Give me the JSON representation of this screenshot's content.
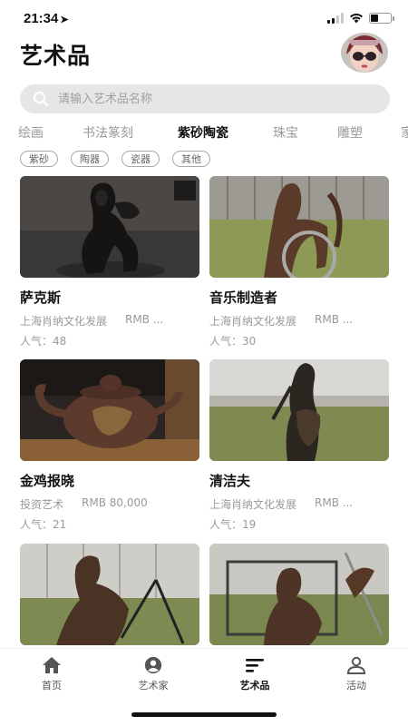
{
  "status_bar": {
    "time": "21:34",
    "location_glyph": "➤"
  },
  "header": {
    "title": "艺术品"
  },
  "search": {
    "placeholder": "请输入艺术品名称"
  },
  "category_tabs": [
    {
      "label": "绘画"
    },
    {
      "label": "书法篆刻"
    },
    {
      "label": "紫砂陶瓷",
      "active": true
    },
    {
      "label": "珠宝"
    },
    {
      "label": "雕塑"
    },
    {
      "label": "家"
    }
  ],
  "filter_chips": [
    {
      "label": "紫砂"
    },
    {
      "label": "陶器"
    },
    {
      "label": "瓷器"
    },
    {
      "label": "其他"
    }
  ],
  "artworks": [
    {
      "title": "萨克斯",
      "seller": "上海肖纳文化发展",
      "price": "RMB ...",
      "popularity": "人气：48"
    },
    {
      "title": "音乐制造者",
      "seller": "上海肖纳文化发展",
      "price": "RMB ...",
      "popularity": "人气：30"
    },
    {
      "title": "金鸡报晓",
      "seller": "投资艺术",
      "price": "RMB 80,000",
      "popularity": "人气：21"
    },
    {
      "title": "清洁夫",
      "seller": "上海肖纳文化发展",
      "price": "RMB ...",
      "popularity": "人气：19"
    },
    {
      "title": "",
      "seller": "",
      "price": "",
      "popularity": ""
    },
    {
      "title": "",
      "seller": "",
      "price": "",
      "popularity": ""
    }
  ],
  "bottom_nav": [
    {
      "label": "首页",
      "icon": "home-icon"
    },
    {
      "label": "艺术家",
      "icon": "artist-icon"
    },
    {
      "label": "艺术品",
      "icon": "artwork-icon",
      "active": true
    },
    {
      "label": "活动",
      "icon": "event-icon"
    }
  ]
}
